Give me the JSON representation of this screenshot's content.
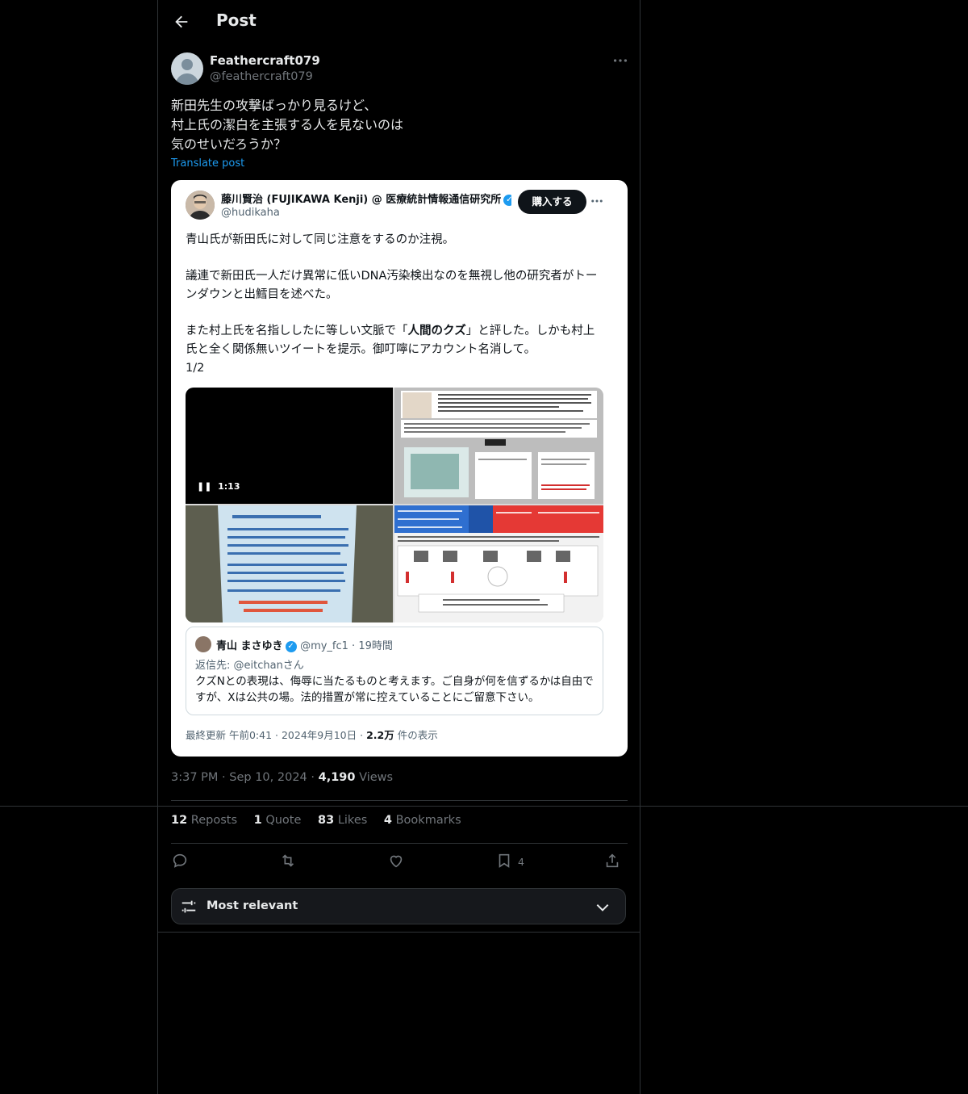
{
  "header": {
    "title": "Post"
  },
  "post": {
    "display_name": "Feathercraft079",
    "handle": "@feathercraft079",
    "text": "新田先生の攻撃ばっかり見るけど、\n村上氏の潔白を主張する人を見ないのは\n気のせいだろうか？",
    "translate_label": "Translate post",
    "time": "3:37 PM",
    "date": "Sep 10, 2024",
    "views_count": "4,190",
    "views_label": "Views"
  },
  "embed": {
    "name": "藤川賢治 (FUJIKAWA Kenji) @ 医療統計情報通信研究所",
    "handle": "@hudikaha",
    "buy_label": "購入する",
    "p1": "青山氏が新田氏に対して同じ注意をするのか注視。",
    "p2": "議連で新田氏一人だけ異常に低いDNA汚染検出なのを無視し他の研究者がトーンダウンと出鱈目を述べた。",
    "p3_pre": "また村上氏を名指ししたに等しい文脈で「",
    "p3_bold": "人間のクズ",
    "p3_post": "」と評した。しかも村上氏と全く関係無いツイートを提示。御叮嚀にアカウント名消して。",
    "p3_page": "1/2",
    "video_time": "1:13",
    "quote": {
      "name": "青山 まさゆき",
      "handle": "@my_fc1",
      "time": "19時間",
      "reply_to": "返信先: @eitchanさん",
      "body": "クズNとの表現は、侮辱に当たるものと考えます。ご自身が何を信ずるかは自由ですが、Xは公共の場。法的措置が常に控えていることにご留意下さい。"
    },
    "footer_prefix": "最終更新 午前0:41 · 2024年9月10日 · ",
    "footer_views": "2.2万",
    "footer_suffix": " 件の表示"
  },
  "stats": {
    "reposts_count": "12",
    "reposts_label": "Reposts",
    "quote_count": "1",
    "quote_label": "Quote",
    "likes_count": "83",
    "likes_label": "Likes",
    "bookmarks_count": "4",
    "bookmarks_label": "Bookmarks"
  },
  "actions": {
    "bookmark_count": "4"
  },
  "sort": {
    "label": "Most relevant"
  },
  "colors": {
    "background": "#000000",
    "accent": "#1d9bf0",
    "border": "#2f3336",
    "muted": "#71767b"
  },
  "icons": [
    "back-arrow-icon",
    "more-icon",
    "reply-icon",
    "repost-icon",
    "like-icon",
    "bookmark-icon",
    "share-icon",
    "sort-sliders-icon",
    "chevron-down-icon",
    "verified-icon",
    "pause-icon"
  ]
}
